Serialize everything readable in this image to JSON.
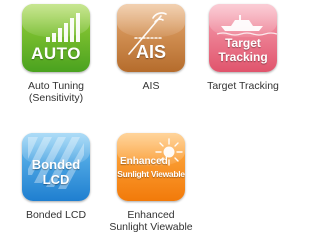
{
  "features": [
    {
      "id": "auto",
      "tile_text": "AUTO",
      "caption": "Auto Tuning\n(Sensitivity)",
      "icon": "signal-bars-icon",
      "color": "#6bbb2a"
    },
    {
      "id": "ais",
      "tile_text": "AIS",
      "caption": "AIS",
      "icon": "ais-antenna-icon",
      "color": "#d08a4a"
    },
    {
      "id": "target",
      "tile_text_line1": "Target",
      "tile_text_line2": "Tracking",
      "caption": "Target Tracking",
      "icon": "boat-icon",
      "color": "#ec7a8e"
    },
    {
      "id": "bonded",
      "tile_text_line1": "Bonded",
      "tile_text_line2": "LCD",
      "caption": "Bonded LCD",
      "icon": "lcd-stripes-icon",
      "color": "#3a9be0"
    },
    {
      "id": "sun",
      "tile_text_line1": "Enhanced",
      "tile_text_line2": "Sunlight Viewable",
      "caption": "Enhanced\nSunlight Viewable",
      "icon": "sun-icon",
      "color": "#f7921e"
    }
  ]
}
